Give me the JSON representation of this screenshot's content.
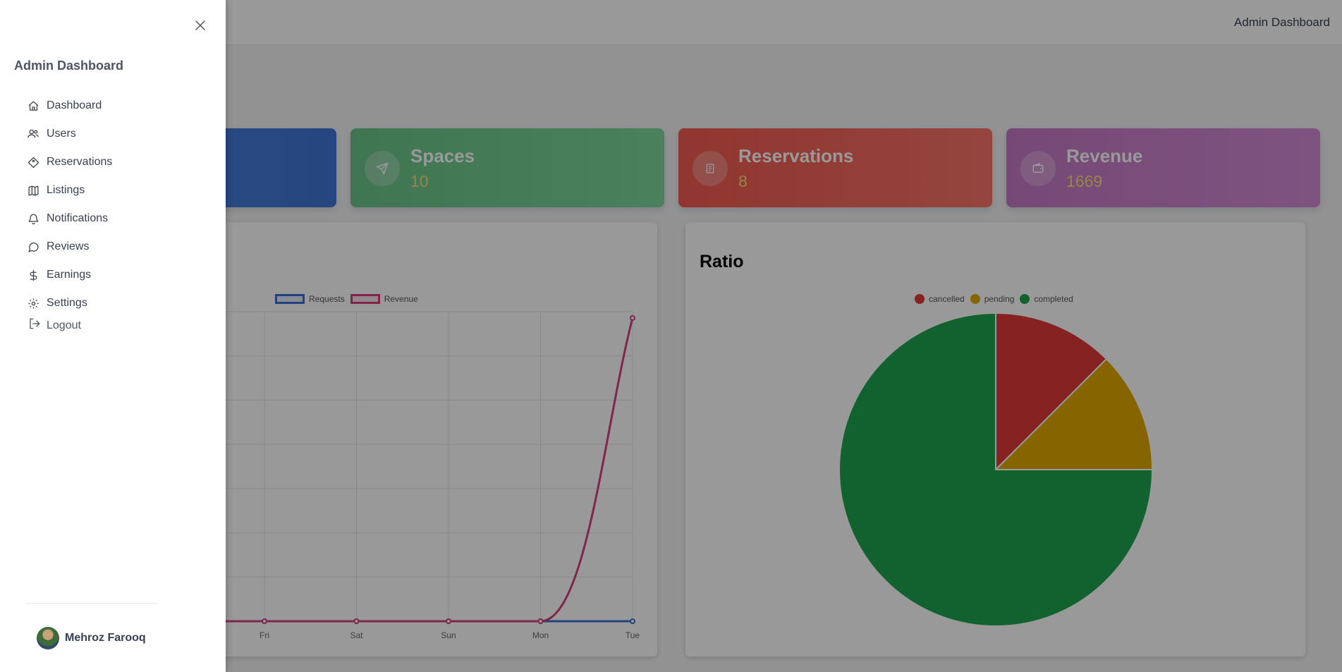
{
  "app": {
    "topbar_title": "Admin Dashboard"
  },
  "drawer": {
    "title": "Admin Dashboard",
    "nav": [
      {
        "label": "Dashboard",
        "icon": "home-icon"
      },
      {
        "label": "Users",
        "icon": "users-icon"
      },
      {
        "label": "Reservations",
        "icon": "tag-icon"
      },
      {
        "label": "Listings",
        "icon": "map-icon"
      },
      {
        "label": "Notifications",
        "icon": "bell-icon"
      },
      {
        "label": "Reviews",
        "icon": "message-icon"
      },
      {
        "label": "Earnings",
        "icon": "dollar-icon"
      },
      {
        "label": "Settings",
        "icon": "gear-icon"
      }
    ],
    "logout_label": "Logout",
    "user_name": "Mehroz Farooq"
  },
  "stats": {
    "spaces": {
      "label": "Spaces",
      "value": "10"
    },
    "reservations": {
      "label": "Reservations",
      "value": "8"
    },
    "revenue": {
      "label": "Revenue",
      "value": "1669"
    }
  },
  "colors": {
    "requests": "#3b6fd1",
    "revenue": "#d6407f",
    "cancelled": "#e03a3a",
    "pending": "#e0a800",
    "completed": "#1fa34f"
  },
  "chart_data": [
    {
      "type": "line",
      "title": "",
      "categories": [
        "Fri",
        "Sat",
        "Sun",
        "Mon",
        "Tue"
      ],
      "series": [
        {
          "name": "Requests",
          "values": [
            0,
            0,
            0,
            0,
            0
          ]
        },
        {
          "name": "Revenue",
          "values": [
            0,
            0,
            0,
            0,
            1669
          ]
        }
      ],
      "legend": "top"
    },
    {
      "type": "pie",
      "title": "Ratio",
      "labels": [
        "cancelled",
        "pending",
        "completed"
      ],
      "values": [
        1,
        1,
        6
      ],
      "legend": "top"
    }
  ]
}
